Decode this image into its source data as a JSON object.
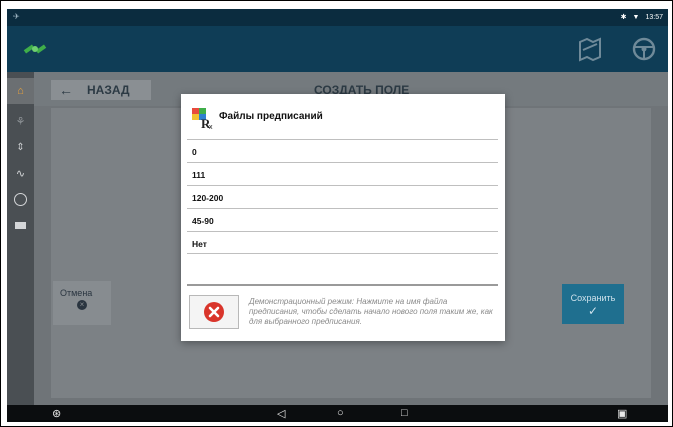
{
  "status_bar": {
    "time": "13:57"
  },
  "screen": {
    "back_label": "НАЗАД",
    "title": "СОЗДАТЬ ПОЛЕ",
    "cancel_label": "Отмена",
    "save_label": "Сохранить"
  },
  "dialog": {
    "title": "Файлы предписаний",
    "files": [
      "0",
      "111",
      "120-200",
      "45-90",
      "Нет"
    ],
    "demo_message": "Демонстрационный режим: Нажмите на имя файла предписания, чтобы сделать начало нового поля таким же, как для выбранного предписания."
  },
  "sidebar": {
    "items": [
      "home-icon",
      "spray-icon",
      "field-icon",
      "pulse-icon",
      "speed-icon",
      "camera-icon"
    ]
  },
  "colors": {
    "app_bar": "#0f3d56",
    "accent_save": "#1f6f8f",
    "error_red": "#d9352b",
    "home_orange": "#e8a23a"
  }
}
